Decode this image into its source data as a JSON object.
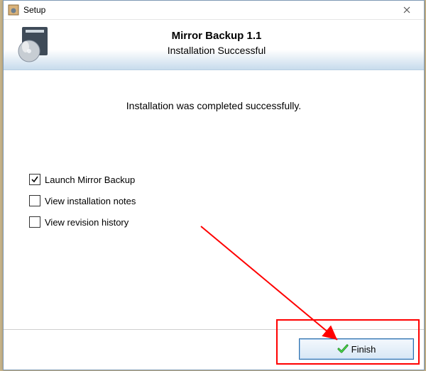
{
  "titlebar": {
    "title": "Setup"
  },
  "header": {
    "title": "Mirror Backup 1.1",
    "subtitle": "Installation Successful"
  },
  "message": "Installation was completed successfully.",
  "checks": {
    "launch": {
      "label": "Launch Mirror Backup",
      "checked": true
    },
    "notes": {
      "label": "View installation notes",
      "checked": false
    },
    "history": {
      "label": "View revision history",
      "checked": false
    }
  },
  "buttons": {
    "finish": "Finish"
  }
}
